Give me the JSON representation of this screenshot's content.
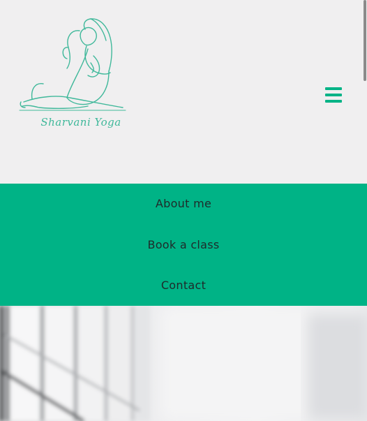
{
  "brand": {
    "logo_text": "Sharvani Yoga",
    "accent_color": "#00b386"
  },
  "header": {
    "menu_icon": "hamburger-menu-icon"
  },
  "nav": {
    "items": [
      {
        "label": "About me"
      },
      {
        "label": "Book a class"
      },
      {
        "label": "Contact"
      }
    ]
  },
  "hero": {
    "image": "blurred bright studio window photo"
  }
}
